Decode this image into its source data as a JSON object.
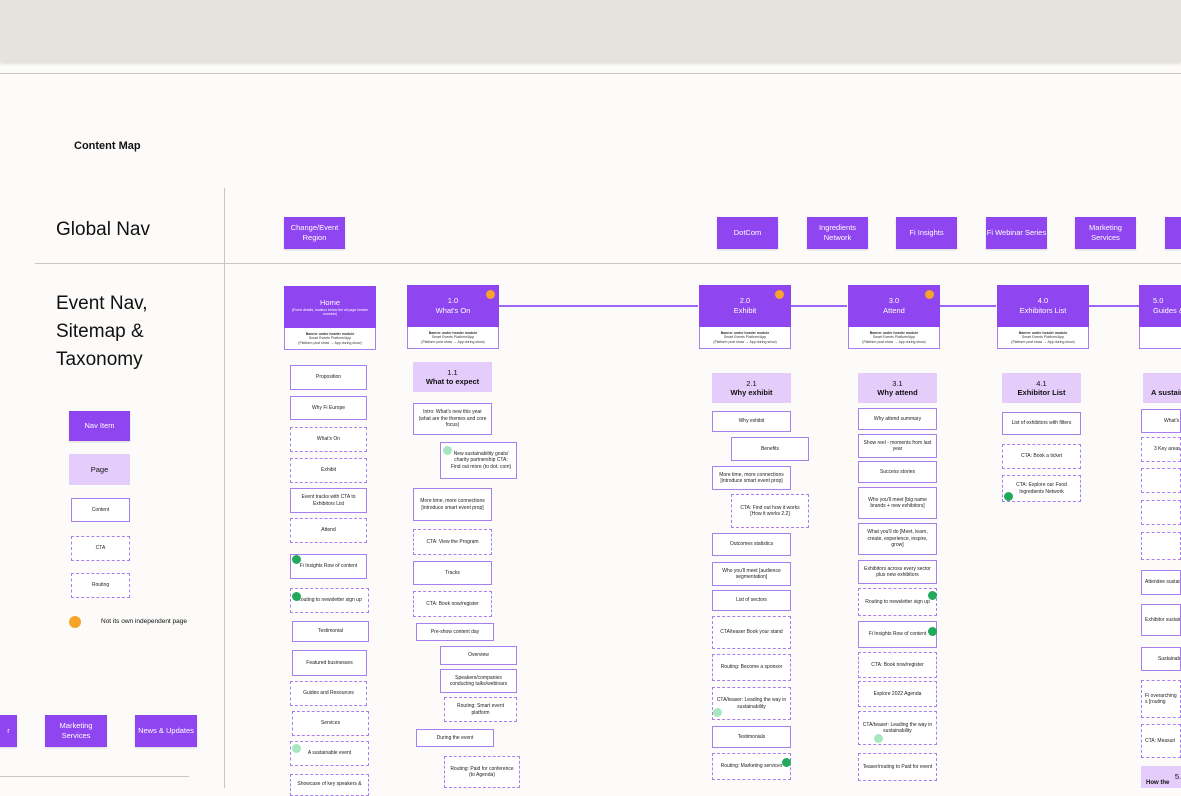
{
  "title": "Content Map",
  "sections": {
    "global_nav": "Global Nav",
    "event_nav_l1": "Event Nav,",
    "event_nav_l2": "Sitemap &",
    "event_nav_l3": "Taxonomy"
  },
  "colors": {
    "nav_item": "#8f45f0",
    "page": "#e4ccfb",
    "content_border": "#a880ee",
    "not_own_page": "#f7a42b",
    "green_marker": "#22aa5a"
  },
  "legend": {
    "nav_item": "Nav Item",
    "page": "Page",
    "content": "Content",
    "cta": "CTA",
    "routing": "Routing",
    "not_own_page": "Not its own independent page"
  },
  "global_nav": {
    "change_event_region": "Change/Event Region",
    "dotcom": "DotCom",
    "ingredients_network": "Ingredients Network",
    "fi_insights": "Fi Insights",
    "fi_webinar_series": "Fi Webinar Series",
    "marketing_services": "Marketing Services"
  },
  "bottom_nav": {
    "marketing_services": "Marketing Services",
    "news_updates": "News & Updates"
  },
  "header_common": {
    "banner_l1": "Banner under header module",
    "banner_l2": "Smart Events Platform/App",
    "banner_l3": "(Platform post show → App during show)"
  },
  "home": {
    "title": "Home",
    "subtitle": "(Event details, location below the all page header modules)",
    "items": [
      "Proposition",
      "Why Fi Europe",
      "What's On",
      "Exhibit",
      "Event tracks with CTA to Exhibitors List",
      "Attend",
      "Fi Insights Row of content",
      "Routing to newsletter sign up",
      "Testimonial",
      "Featured businesses",
      "Guides and Resources",
      "Services",
      "A sustainable event",
      "Showcase of key speakers &"
    ]
  },
  "whats_on": {
    "number": "1.0",
    "title": "What's On",
    "page_number": "1.1",
    "page_title": "What to expect",
    "items": [
      "Intro: What's new this year (what are the themes and core focus)",
      "New sustainability goals/ charity partnership CTA: Find out more (to dot. com)",
      "More time, more connections [introduce smart event prop]",
      "CTA: View the Program",
      "Tracks",
      "CTA: Book now/register",
      "Pre-show content day",
      "Overview",
      "Speakers/companies conducting talks/webinars",
      "Routing: Smart event platform",
      "During the event",
      "Routing: Paid for conference (to Agenda)"
    ]
  },
  "exhibit": {
    "number": "2.0",
    "title": "Exhibit",
    "page_number": "2.1",
    "page_title": "Why exhibit",
    "items": [
      "Why exhibit",
      "Benefits",
      "More time, more connections [introduce smart event prop]",
      "CTA: Find out how it works [How it works 2.2]",
      "Outcomes statistics",
      "Who you'll meet [audience segmentation]",
      "List of sectors",
      "CTA/teaser Book your stand",
      "Routing: Become a sponsor",
      "CTA/teaser: Leading the way in sustainability",
      "Testimonials",
      "Routing: Marketing services"
    ]
  },
  "attend": {
    "number": "3.0",
    "title": "Attend",
    "page_number": "3.1",
    "page_title": "Why attend",
    "items": [
      "Why attend summary",
      "Show reel - moments from last year",
      "Success stories",
      "Who you'll meet [big name brands + new exhibitors]",
      "What you'll do [Meet, learn, create, experience, inspire, grow]",
      "Exhibitors across every sector plus new exhibitors",
      "Routing to newsletter sign up",
      "Fi Insights Row of content",
      "CTA: Book now/register",
      "Explore 2022 Agenda",
      "CTA/teaser: Leading the way in sustainability",
      "Teaser/routing to Paid for event"
    ]
  },
  "exhibitors_list": {
    "number": "4.0",
    "title": "Exhibitors List",
    "page_number": "4.1",
    "page_title": "Exhibitor List",
    "items": [
      "List of exhibitors with filters",
      "CTA: Book a ticket",
      "CTA: Explore our Food Ingredients Network"
    ]
  },
  "guides": {
    "number": "5.0",
    "title": "Guides &",
    "page_number": "5",
    "page_title": "A sustaina",
    "items": [
      "What's n",
      "3 Key areas",
      "Attendee sustain",
      "Exhibitor sustain",
      "Sustainab",
      "Fi overarching s [routing",
      "CTA: Measuri",
      "How the"
    ],
    "bottom_number": "5."
  }
}
